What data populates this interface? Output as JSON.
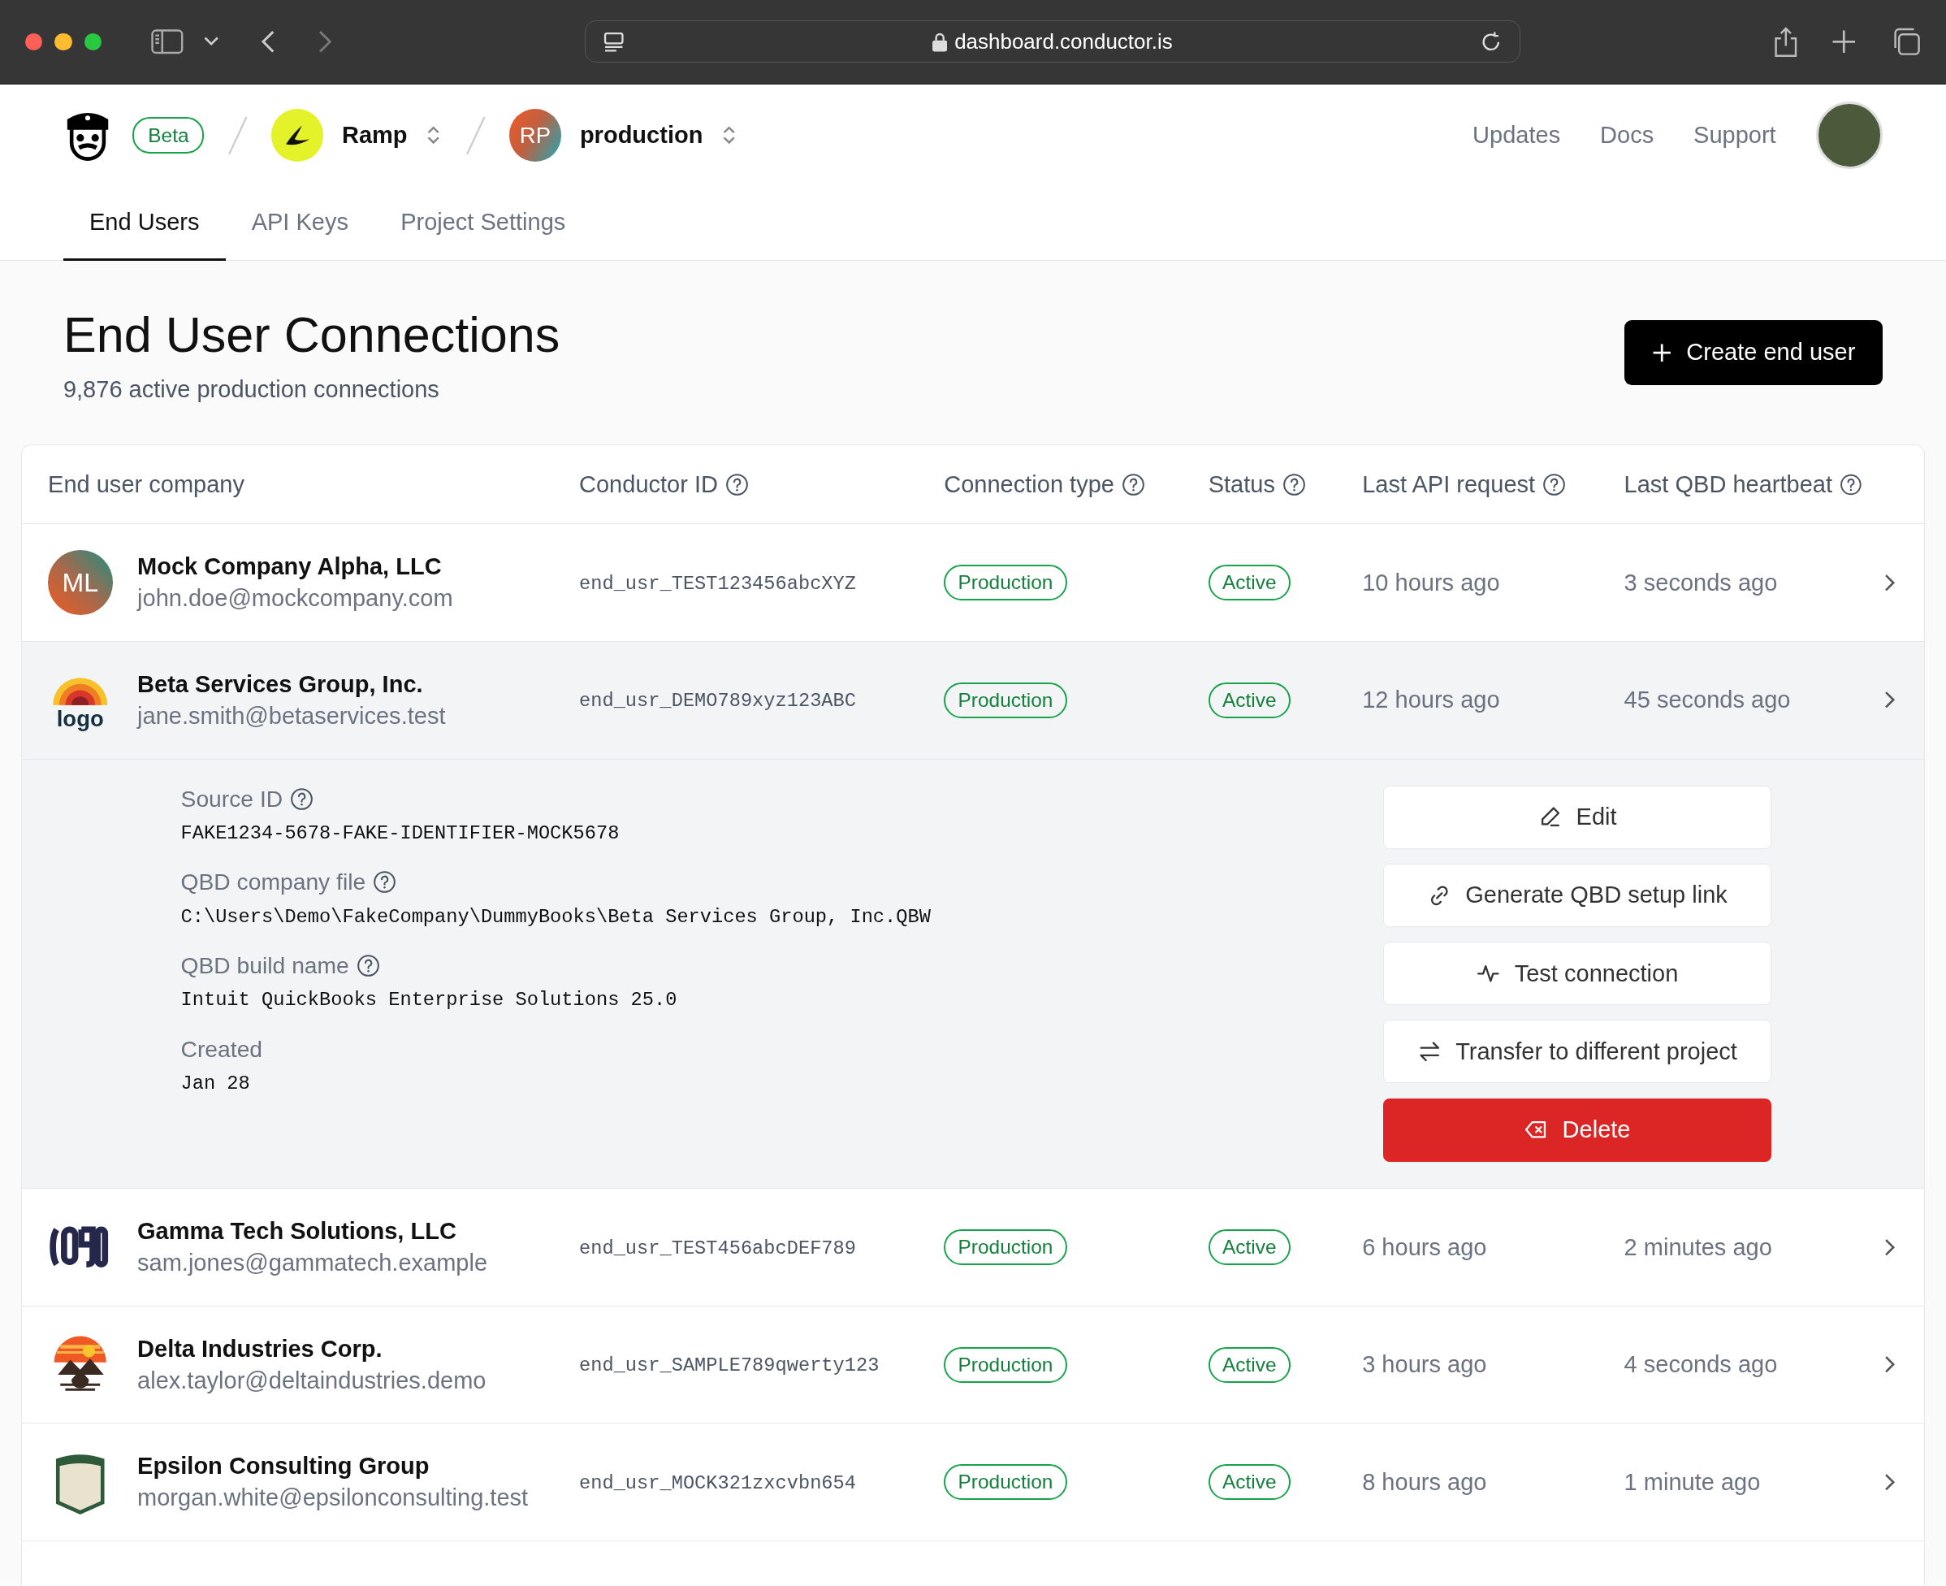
{
  "browser": {
    "url": "dashboard.conductor.is"
  },
  "header": {
    "badge": "Beta",
    "org": {
      "name": "Ramp"
    },
    "project": {
      "initials": "RP",
      "name": "production"
    },
    "links": [
      "Updates",
      "Docs",
      "Support"
    ]
  },
  "tabs": [
    {
      "label": "End Users",
      "selected": true
    },
    {
      "label": "API Keys",
      "selected": false
    },
    {
      "label": "Project Settings",
      "selected": false
    }
  ],
  "page": {
    "title": "End User Connections",
    "subtitle": "9,876 active production connections",
    "create_button": "Create end user"
  },
  "table": {
    "columns": [
      {
        "label": "End user company",
        "help": false
      },
      {
        "label": "Conductor ID",
        "help": true
      },
      {
        "label": "Connection type",
        "help": true
      },
      {
        "label": "Status",
        "help": true
      },
      {
        "label": "Last API request",
        "help": true
      },
      {
        "label": "Last QBD heartbeat",
        "help": true
      }
    ],
    "rows": [
      {
        "logo": {
          "kind": "initials",
          "text": "ML"
        },
        "company": "Mock Company Alpha, LLC",
        "email": "john.doe@mockcompany.com",
        "conductor_id": "end_usr_TEST123456abcXYZ",
        "connection_type": "Production",
        "status": "Active",
        "last_api_request": "10 hours ago",
        "last_qbd_heartbeat": "3 seconds ago",
        "expanded": false
      },
      {
        "logo": {
          "kind": "rainbow",
          "text": "logo"
        },
        "company": "Beta Services Group, Inc.",
        "email": "jane.smith@betaservices.test",
        "conductor_id": "end_usr_DEMO789xyz123ABC",
        "connection_type": "Production",
        "status": "Active",
        "last_api_request": "12 hours ago",
        "last_qbd_heartbeat": "45 seconds ago",
        "expanded": true,
        "details": {
          "fields": [
            {
              "label": "Source ID",
              "help": true,
              "value": "FAKE1234-5678-FAKE-IDENTIFIER-MOCK5678"
            },
            {
              "label": "QBD company file",
              "help": true,
              "value": "C:\\Users\\Demo\\FakeCompany\\DummyBooks\\Beta Services Group, Inc.QBW"
            },
            {
              "label": "QBD build name",
              "help": true,
              "value": "Intuit QuickBooks Enterprise Solutions 25.0"
            },
            {
              "label": "Created",
              "help": false,
              "value": "Jan 28"
            }
          ],
          "actions": [
            {
              "kind": "edit",
              "label": "Edit"
            },
            {
              "kind": "link",
              "label": "Generate QBD setup link"
            },
            {
              "kind": "pulse",
              "label": "Test connection"
            },
            {
              "kind": "transfer",
              "label": "Transfer to different project"
            },
            {
              "kind": "delete",
              "label": "Delete"
            }
          ]
        }
      },
      {
        "logo": {
          "kind": "bars"
        },
        "company": "Gamma Tech Solutions, LLC",
        "email": "sam.jones@gammatech.example",
        "conductor_id": "end_usr_TEST456abcDEF789",
        "connection_type": "Production",
        "status": "Active",
        "last_api_request": "6 hours ago",
        "last_qbd_heartbeat": "2 minutes ago",
        "expanded": false
      },
      {
        "logo": {
          "kind": "sunset"
        },
        "company": "Delta Industries Corp.",
        "email": "alex.taylor@deltaindustries.demo",
        "conductor_id": "end_usr_SAMPLE789qwerty123",
        "connection_type": "Production",
        "status": "Active",
        "last_api_request": "3 hours ago",
        "last_qbd_heartbeat": "4 seconds ago",
        "expanded": false
      },
      {
        "logo": {
          "kind": "shield"
        },
        "company": "Epsilon Consulting Group",
        "email": "morgan.white@epsilonconsulting.test",
        "conductor_id": "end_usr_MOCK321zxcvbn654",
        "connection_type": "Production",
        "status": "Active",
        "last_api_request": "8 hours ago",
        "last_qbd_heartbeat": "1 minute ago",
        "expanded": false
      }
    ]
  }
}
